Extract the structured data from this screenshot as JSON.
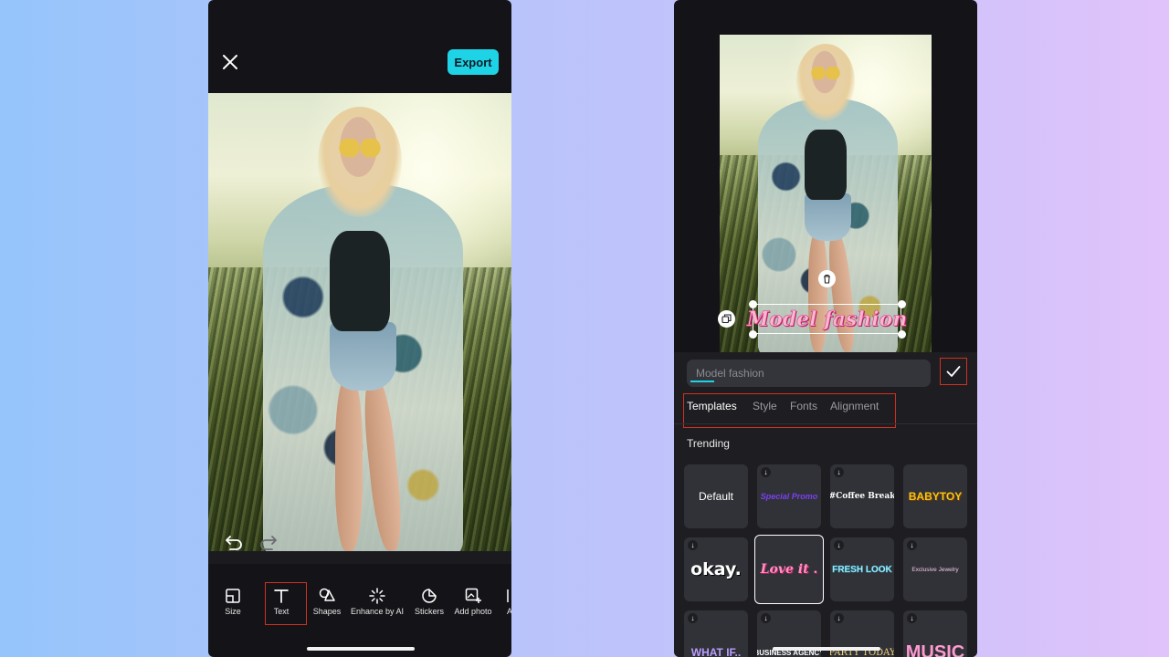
{
  "editor": {
    "export_label": "Export",
    "toolbar": [
      {
        "label": "Size",
        "icon": "size-icon"
      },
      {
        "label": "Text",
        "icon": "text-icon"
      },
      {
        "label": "Shapes",
        "icon": "shapes-icon"
      },
      {
        "label": "Enhance by AI",
        "icon": "sparkle-icon"
      },
      {
        "label": "Stickers",
        "icon": "sticker-icon"
      },
      {
        "label": "Add photo",
        "icon": "add-photo-icon"
      },
      {
        "label": "A",
        "icon": "partial-tool-icon"
      }
    ]
  },
  "text_editor": {
    "overlay_text": "Model fashion",
    "input_placeholder": "Model fashion",
    "tabs": [
      "Templates",
      "Style",
      "Fonts",
      "Alignment"
    ],
    "active_tab": "Templates",
    "section_title": "Trending",
    "templates": [
      {
        "label": "Default",
        "color": "#ffffff"
      },
      {
        "label": "Special Promo",
        "color": "#7b3ff2"
      },
      {
        "label": "#Coffee Break",
        "color": "#ffffff"
      },
      {
        "label": "BABYTOY",
        "color": "#f5c518"
      },
      {
        "label": "okay.",
        "color": "#ffffff"
      },
      {
        "label": "Love it .",
        "color": "#ff8fbf"
      },
      {
        "label": "FRESH LOOK",
        "color": "#bff3ff"
      },
      {
        "label": "Exclusive Jewelry",
        "color": "#f2c9e8"
      },
      {
        "label": "WHAT IF..",
        "color": "#b99cff"
      },
      {
        "label": "BUSINESS AGENCY",
        "color": "#ffffff"
      },
      {
        "label": "PARTY TODAY",
        "color": "#f1d27a"
      },
      {
        "label": "MUSIC",
        "color": "#ff9ad1"
      }
    ]
  },
  "colors": {
    "accent": "#1fd3e6",
    "highlight": "#d1301f",
    "panel": "#1e1e22"
  }
}
